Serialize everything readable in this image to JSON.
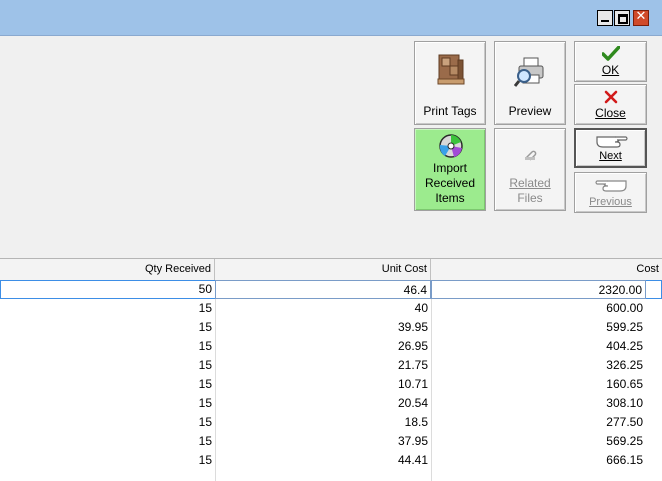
{
  "window": {
    "controls": {
      "minimize": "minimize-icon",
      "maximize": "maximize-icon",
      "close": "close-icon"
    },
    "close_glyph": "✕"
  },
  "toolbar": {
    "print_tags": "Print Tags",
    "preview": "Preview",
    "ok": "OK",
    "close": "Close",
    "import_line1": "Import",
    "import_line2": "Received",
    "import_line3": "Items",
    "related_line1": "Related",
    "related_line2": "Files",
    "next": "Next",
    "previous": "Previous"
  },
  "grid": {
    "columns": [
      "Qty Received",
      "Unit Cost",
      "Cost"
    ],
    "rows": [
      {
        "qty": "50",
        "unit": "46.4",
        "cost": "2320.00"
      },
      {
        "qty": "15",
        "unit": "40",
        "cost": "600.00"
      },
      {
        "qty": "15",
        "unit": "39.95",
        "cost": "599.25"
      },
      {
        "qty": "15",
        "unit": "26.95",
        "cost": "404.25"
      },
      {
        "qty": "15",
        "unit": "21.75",
        "cost": "326.25"
      },
      {
        "qty": "15",
        "unit": "10.71",
        "cost": "160.65"
      },
      {
        "qty": "15",
        "unit": "20.54",
        "cost": "308.10"
      },
      {
        "qty": "15",
        "unit": "18.5",
        "cost": "277.50"
      },
      {
        "qty": "15",
        "unit": "37.95",
        "cost": "569.25"
      },
      {
        "qty": "15",
        "unit": "44.41",
        "cost": "666.15"
      }
    ]
  },
  "colors": {
    "titlebar": "#9ec2e8",
    "import_bg": "#9ceb8e",
    "selection": "#3d8ee6"
  }
}
